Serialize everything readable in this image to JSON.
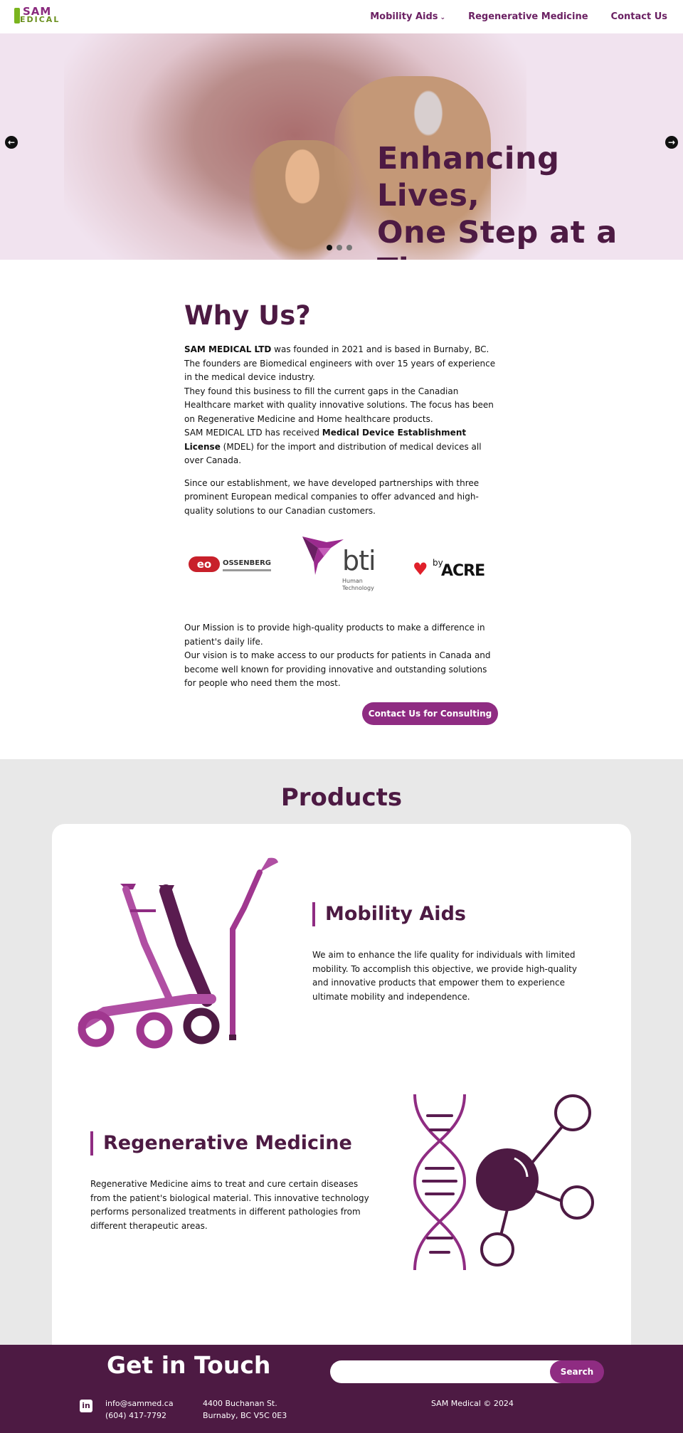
{
  "brand": {
    "logo_top": "SAM",
    "logo_bottom": "EDICAL"
  },
  "nav": {
    "items": [
      "Mobility Aids",
      "Regenerative Medicine",
      "Contact Us"
    ]
  },
  "hero": {
    "title_line1": "Enhancing Lives,",
    "title_line2": "One Step at a Time",
    "prev": "←",
    "next": "→",
    "slides": 3,
    "active_slide": 1
  },
  "why": {
    "heading": "Why Us?",
    "p1_bold": "SAM MEDICAL LTD",
    "p1_rest": " was founded in 2021 and is based in Burnaby, BC.",
    "p2": "The founders are Biomedical engineers with over 15 years of experience in the medical device industry.",
    "p3": "They found this business to fill the current gaps in the Canadian Healthcare market with quality innovative solutions. The focus has been on Regenerative Medicine and Home healthcare products.",
    "p4_pre": "SAM MEDICAL LTD has received ",
    "p4_bold": "Medical Device Establishment License",
    "p4_post": " (MDEL) for the import and distribution of medical devices all over Canada.",
    "p5": "Since our establishment, we have developed partnerships with three prominent European medical companies to offer advanced and high-quality solutions to our Canadian customers."
  },
  "partners": {
    "ossenberg_badge": "eo",
    "ossenberg": "OSSENBERG",
    "bti": "bti",
    "bti_sub1": "Human",
    "bti_sub2": "Technology",
    "acre_by": "by",
    "acre": "ACRE"
  },
  "mission": {
    "p1": "Our Mission is to provide high-quality products to make a difference in patient's daily life.",
    "p2": "Our vision is to make access to our products for patients in Canada and become well known for providing innovative and outstanding solutions for people who need them the most.",
    "cta": "Contact Us for Consulting"
  },
  "products": {
    "heading": "Products",
    "items": [
      {
        "title": "Mobility Aids",
        "desc": "We aim to enhance the life quality for individuals with limited mobility. To accomplish this objective, we provide high-quality and innovative products that empower them to experience ultimate mobility and independence."
      },
      {
        "title": "Regenerative Medicine",
        "desc": "Regenerative Medicine aims to treat and cure certain diseases from the patient's biological material. This innovative technology performs personalized treatments in different pathologies from different therapeutic areas."
      }
    ]
  },
  "footer": {
    "heading": "Get in Touch",
    "search_placeholder": "",
    "search_button": "Search",
    "email": "info@sammed.ca",
    "phone": "(604) 417-7792",
    "address1": "4400 Buchanan St.",
    "address2": "Burnaby, BC V5C 0E3",
    "copyright": "SAM Medical © 2024",
    "linkedin": "in"
  },
  "colors": {
    "primary": "#4d1a43",
    "accent": "#8f2c82",
    "hero_bg": "#f1e3ef",
    "section_bg": "#e8e8e8"
  }
}
